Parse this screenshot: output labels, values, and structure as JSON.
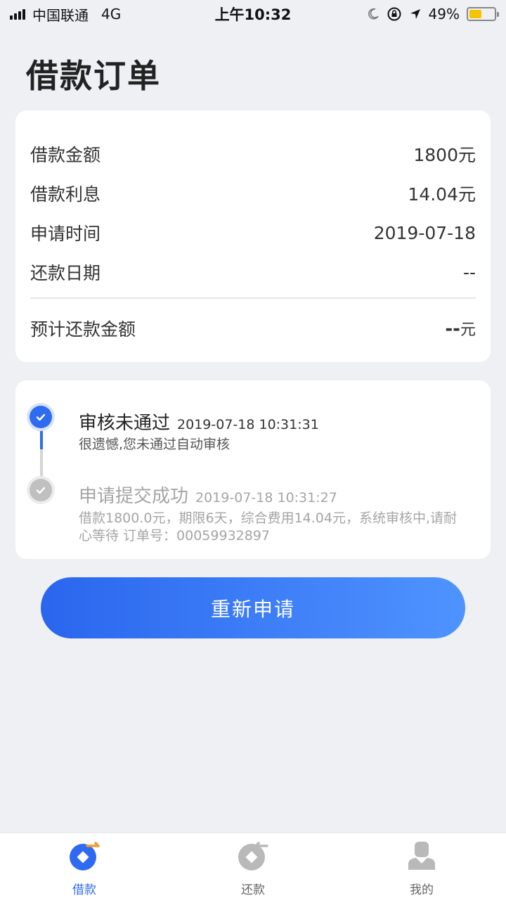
{
  "status_bar": {
    "carrier": "中国联通",
    "network": "4G",
    "time": "上午10:32",
    "battery": "49%",
    "battery_level": 0.49
  },
  "page": {
    "title": "借款订单"
  },
  "loan_info": {
    "rows": [
      {
        "label": "借款金额",
        "value": "1800元"
      },
      {
        "label": "借款利息",
        "value": "14.04元"
      },
      {
        "label": "申请时间",
        "value": "2019-07-18"
      },
      {
        "label": "还款日期",
        "value": "--"
      }
    ],
    "total": {
      "label": "预计还款金额",
      "value": "--",
      "unit": "元"
    }
  },
  "timeline": [
    {
      "title": "审核未通过",
      "time": "2019-07-18 10:31:31",
      "desc": "很遗憾,您未通过自动审核",
      "state": "active"
    },
    {
      "title": "申请提交成功",
      "time": "2019-07-18 10:31:27",
      "desc": "借款1800.0元，期限6天，综合费用14.04元，系统审核中,请耐心等待 订单号：00059932897",
      "state": "inactive"
    }
  ],
  "actions": {
    "reapply_label": "重新申请"
  },
  "tab_bar": {
    "items": [
      {
        "label": "借款",
        "icon": "borrow-icon",
        "selected": true
      },
      {
        "label": "还款",
        "icon": "repay-icon",
        "selected": false
      },
      {
        "label": "我的",
        "icon": "profile-icon",
        "selected": false
      }
    ]
  },
  "colors": {
    "accent": "#2f6bf0",
    "background": "#eef0f4",
    "inactive": "#a5a5a5",
    "battery": "#f5c400"
  }
}
